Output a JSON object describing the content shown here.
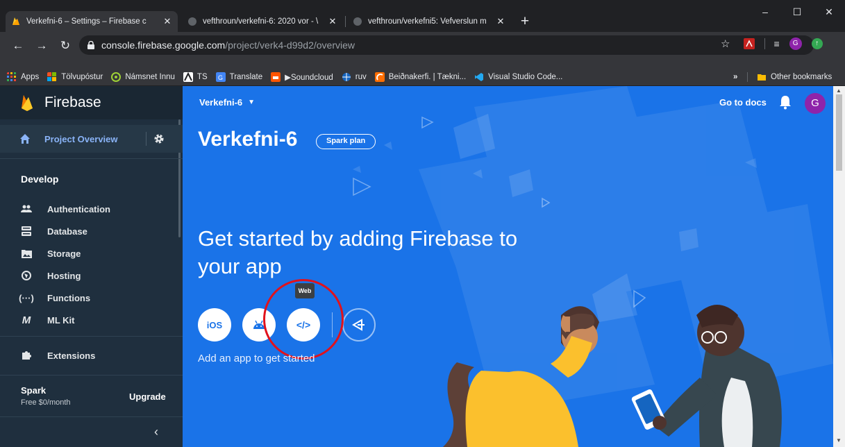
{
  "browser": {
    "tabs": [
      {
        "title": "Verkefni-6 – Settings – Firebase c",
        "icon": "firebase-favicon",
        "active": true
      },
      {
        "title": "vefthroun/verkefni-6: 2020 vor - \\",
        "icon": "github-favicon",
        "active": false
      },
      {
        "title": "vefthroun/verkefni5: Vefverslun m",
        "icon": "github-favicon",
        "active": false
      }
    ],
    "new_tab_label": "+",
    "window_controls": {
      "minimize": "–",
      "maximize": "☐",
      "close": "✕"
    },
    "url_host": "console.firebase.google.com",
    "url_path": "/project/verk4-d99d2/overview",
    "bookmarks": [
      {
        "label": "Apps",
        "color": "#fbbc04"
      },
      {
        "label": "Tölvupóstur",
        "color": "#0f6cbd"
      },
      {
        "label": "Námsnet Innu",
        "color": "#9fd135"
      },
      {
        "label": "TS",
        "color": "#e8eaed"
      },
      {
        "label": "Translate",
        "color": "#4285f4"
      },
      {
        "label": "▶Soundcloud",
        "color": "#ff5500"
      },
      {
        "label": "ruv",
        "color": "#1565c0"
      },
      {
        "label": "Beiðnakerfi. | Tækni...",
        "color": "#ff6d00"
      },
      {
        "label": "Visual Studio Code...",
        "color": "#23a9f2"
      }
    ],
    "bookmarks_more": "»",
    "other_bookmarks": "Other bookmarks"
  },
  "sidebar": {
    "brand": "Firebase",
    "project_overview": "Project Overview",
    "develop_heading": "Develop",
    "items": [
      {
        "label": "Authentication",
        "icon": "people-icon"
      },
      {
        "label": "Database",
        "icon": "database-icon"
      },
      {
        "label": "Storage",
        "icon": "folder-icon"
      },
      {
        "label": "Hosting",
        "icon": "globe-icon"
      },
      {
        "label": "Functions",
        "icon": "functions-icon"
      },
      {
        "label": "ML Kit",
        "icon": "ml-kit-icon"
      }
    ],
    "extensions": "Extensions",
    "plan_name": "Spark",
    "plan_price": "Free $0/month",
    "upgrade": "Upgrade",
    "collapse": "‹"
  },
  "main": {
    "project_switcher": "Verkefni-6",
    "go_to_docs": "Go to docs",
    "avatar_initial": "G",
    "project_title": "Verkefni-6",
    "plan_chip": "Spark plan",
    "headline": "Get started by adding Firebase to your app",
    "app_buttons": [
      {
        "label": "iOS",
        "icon": "ios-icon"
      },
      {
        "label": "",
        "icon": "android-icon"
      },
      {
        "label": "</>",
        "icon": "web-icon"
      },
      {
        "label": "",
        "icon": "unity-icon"
      }
    ],
    "tooltip": "Web",
    "add_app_hint": "Add an app to get started"
  },
  "colors": {
    "brand_blue": "#1a73e8",
    "sidebar_bg": "#1f2f3e",
    "highlight_ring": "#e1121c",
    "avatar": "#8e24aa"
  }
}
